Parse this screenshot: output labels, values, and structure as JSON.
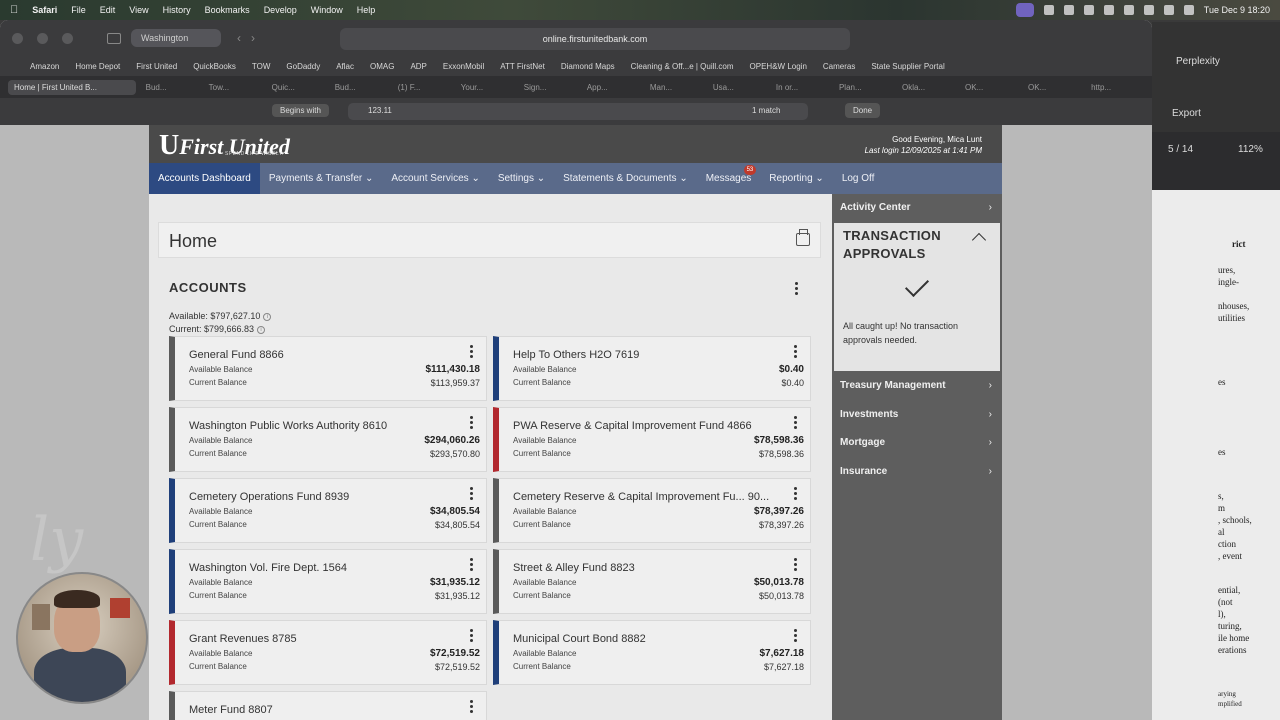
{
  "menubar": {
    "app": "Safari",
    "items": [
      "File",
      "Edit",
      "View",
      "History",
      "Bookmarks",
      "Develop",
      "Window",
      "Help"
    ],
    "clock": "Tue Dec 9 18:20"
  },
  "safari": {
    "tab_group": "Washington",
    "url": "online.firstunitedbank.com",
    "favorites": [
      "Amazon",
      "Home Depot",
      "First United",
      "QuickBooks",
      "TOW",
      "GoDaddy",
      "Aflac",
      "OMAG",
      "ADP",
      "ExxonMobil",
      "ATT FirstNet",
      "Diamond Maps",
      "Cleaning & Off...e | Quill.com",
      "OPEH&W Login",
      "Cameras",
      "State Supplier Portal"
    ],
    "tabs": [
      "Home | First United B...",
      "Bud...",
      "Tow...",
      "Quic...",
      "Bud...",
      "(1) F...",
      "Your...",
      "Sign...",
      "App...",
      "Man...",
      "Usa...",
      "In or...",
      "Plan...",
      "Okla...",
      "OK...",
      "OK...",
      "http..."
    ],
    "find": {
      "mode": "Begins with",
      "query": "123.11",
      "match": "1 match",
      "done": "Done"
    }
  },
  "bg_window": {
    "title_right": "Perplexity",
    "export": "Export",
    "page": "5 / 14",
    "zoom": "112%",
    "lines": [
      "rict",
      "ures,",
      "ingle-",
      "nhouses,",
      "utilities",
      "es",
      "es",
      "s,",
      "m",
      ", schools,",
      "al",
      "ction",
      ", event",
      "ential,",
      "(not",
      "l),",
      "turing,",
      "ile home",
      "erations",
      "arying",
      "mplified"
    ]
  },
  "site": {
    "logo": "First United",
    "tagline": "SPEND LIFE WISELY.",
    "greeting": "Good Evening, Mica Lunt",
    "last_login": "Last login 12/09/2025 at 1:41 PM",
    "nav": [
      {
        "label": "Accounts Dashboard",
        "active": true
      },
      {
        "label": "Payments & Transfer",
        "caret": true
      },
      {
        "label": "Account Services",
        "caret": true
      },
      {
        "label": "Settings",
        "caret": true
      },
      {
        "label": "Statements & Documents",
        "caret": true
      },
      {
        "label": "Messages",
        "badge": "53"
      },
      {
        "label": "Reporting",
        "caret": true
      },
      {
        "label": "Log Off"
      }
    ],
    "home_title": "Home",
    "accounts_title": "ACCOUNTS",
    "available_total": "Available: $797,627.10",
    "current_total": "Current: $799,666.83",
    "avail_label": "Available Balance",
    "curr_label": "Current Balance",
    "accounts": [
      {
        "name": "General Fund 8866",
        "available": "$111,430.18",
        "current": "$113,959.37",
        "color": "#5a5a5a"
      },
      {
        "name": "Help To Others H2O 7619",
        "available": "$0.40",
        "current": "$0.40",
        "color": "#1f3f7a"
      },
      {
        "name": "Washington Public Works Authority 8610",
        "available": "$294,060.26",
        "current": "$293,570.80",
        "color": "#5a5a5a"
      },
      {
        "name": "PWA Reserve & Capital Improvement Fund 4866",
        "available": "$78,598.36",
        "current": "$78,598.36",
        "color": "#b2282e"
      },
      {
        "name": "Cemetery Operations Fund 8939",
        "available": "$34,805.54",
        "current": "$34,805.54",
        "color": "#1f3f7a"
      },
      {
        "name": "Cemetery Reserve & Capital Improvement Fu... 90...",
        "available": "$78,397.26",
        "current": "$78,397.26",
        "color": "#5a5a5a"
      },
      {
        "name": "Washington Vol. Fire Dept. 1564",
        "available": "$31,935.12",
        "current": "$31,935.12",
        "color": "#1f3f7a"
      },
      {
        "name": "Street & Alley Fund 8823",
        "available": "$50,013.78",
        "current": "$50,013.78",
        "color": "#5a5a5a"
      },
      {
        "name": "Grant Revenues 8785",
        "available": "$72,519.52",
        "current": "$72,519.52",
        "color": "#b2282e"
      },
      {
        "name": "Municipal Court Bond 8882",
        "available": "$7,627.18",
        "current": "$7,627.18",
        "color": "#1f3f7a"
      },
      {
        "name": "Meter Fund 8807",
        "available": "",
        "current": "",
        "color": "#5a5a5a"
      }
    ],
    "side": {
      "activity": "Activity Center",
      "tx_title": "TRANSACTION APPROVALS",
      "tx_message": "All caught up! No transaction approvals needed.",
      "items": [
        "Treasury Management",
        "Investments",
        "Mortgage",
        "Insurance"
      ]
    }
  }
}
